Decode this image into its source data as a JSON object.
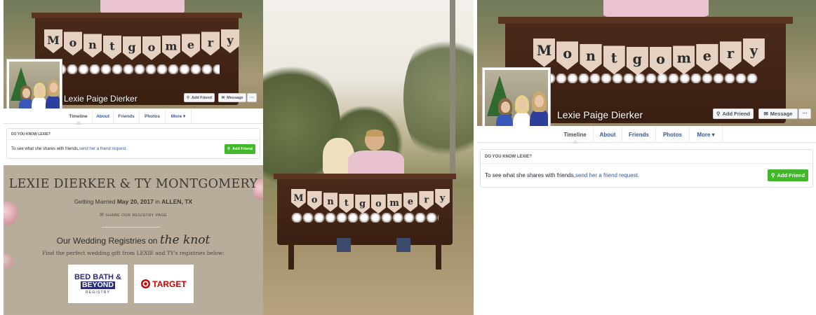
{
  "colors": {
    "fb_link": "#365899",
    "fb_green": "#42b72a",
    "registry_bg": "#b7ab99",
    "bbb_blue": "#2a2d7c",
    "target_red": "#cc0000"
  },
  "banner_letters": [
    "M",
    "o",
    "n",
    "t",
    "g",
    "o",
    "m",
    "e",
    "r",
    "y"
  ],
  "profile_small": {
    "name": "Lexie Paige Dierker",
    "add_friend": "Add Friend",
    "message": "Message",
    "more_dots": "···",
    "tabs": [
      {
        "label": "Timeline"
      },
      {
        "label": "About"
      },
      {
        "label": "Friends"
      },
      {
        "label": "Photos"
      },
      {
        "label": "More ▾"
      }
    ],
    "know_header": "DO YOU KNOW LEXIE?",
    "know_text": "To see what she shares with friends, ",
    "know_link": "send her a friend request.",
    "green_button": "Add Friend"
  },
  "profile_large": {
    "name": "Lexie Paige Dierker",
    "add_friend": "Add Friend",
    "message": "Message",
    "more_dots": "···",
    "tabs": [
      {
        "label": "Timeline"
      },
      {
        "label": "About"
      },
      {
        "label": "Friends"
      },
      {
        "label": "Photos"
      },
      {
        "label": "More ▾"
      }
    ],
    "know_header": "DO YOU KNOW LEXIE?",
    "know_text": "To see what she shares with friends, ",
    "know_link": "send her a friend request.",
    "green_button": "Add Friend"
  },
  "registry": {
    "title": "LEXIE DIERKER & TY MONTGOMERY",
    "date_prefix": "Getting Married ",
    "date": "May 20, 2017",
    "date_mid": " in ",
    "location": "ALLEN, TX",
    "share": "SHARE OUR REGISTRY PAGE",
    "heading": "Our Wedding Registries on ",
    "heading_brand": "the knot",
    "find_text": "Find the perfect wedding gift from LEXIE and TY's registries below:",
    "bbb_line1": "BED BATH &",
    "bbb_line2": "BEYOND",
    "bbb_line3": "REGISTRY",
    "target_label": "TARGET"
  }
}
